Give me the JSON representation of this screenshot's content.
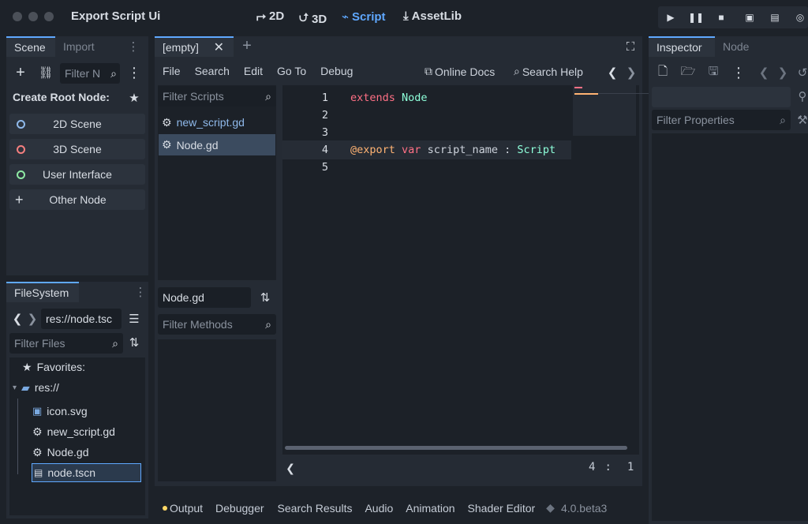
{
  "titlebar": {
    "title": "Export Script Ui",
    "workspaces": [
      {
        "label": "2D",
        "icon": "2d-icon"
      },
      {
        "label": "3D",
        "icon": "3d-icon"
      },
      {
        "label": "Script",
        "icon": "script-icon"
      },
      {
        "label": "AssetLib",
        "icon": "assetlib-icon"
      }
    ],
    "active_workspace": "Script"
  },
  "scene_dock": {
    "tabs": [
      "Scene",
      "Import"
    ],
    "filter_placeholder": "Filter N",
    "create_root_label": "Create Root Node:",
    "root_buttons": [
      {
        "label": "2D Scene",
        "color": "#8fb9ea"
      },
      {
        "label": "3D Scene",
        "color": "#f57f7f"
      },
      {
        "label": "User Interface",
        "color": "#8eeaa4"
      },
      {
        "label": "Other Node",
        "color": "#d8dde4"
      }
    ]
  },
  "filesystem_dock": {
    "tab": "FileSystem",
    "path": "res://node.tsc",
    "filter_placeholder": "Filter Files",
    "favorites_label": "Favorites:",
    "root_label": "res://",
    "files": [
      {
        "name": "icon.svg",
        "icon": "image-icon"
      },
      {
        "name": "new_script.gd",
        "icon": "gear-icon"
      },
      {
        "name": "Node.gd",
        "icon": "gear-icon"
      },
      {
        "name": "node.tscn",
        "icon": "scene-icon"
      }
    ]
  },
  "script_editor": {
    "tab": "[empty]",
    "menu": [
      "File",
      "Search",
      "Edit",
      "Go To",
      "Debug"
    ],
    "online_docs": "Online Docs",
    "search_help": "Search Help",
    "filter_scripts_placeholder": "Filter Scripts",
    "scripts": [
      "new_script.gd",
      "Node.gd"
    ],
    "current_script": "Node.gd",
    "filter_methods_placeholder": "Filter Methods",
    "line_numbers": [
      "1",
      "2",
      "3",
      "4",
      "5"
    ],
    "line1": {
      "kw": "extends",
      "type": "Node"
    },
    "line4": {
      "annot": "@export",
      "kw": "var",
      "name": "script_name",
      "colon": ":",
      "type": "Script"
    },
    "cursor_line": "4",
    "cursor_sep": ":",
    "cursor_col": "1"
  },
  "bottom_panel": {
    "tabs": [
      "Output",
      "Debugger",
      "Search Results",
      "Audio",
      "Animation",
      "Shader Editor"
    ],
    "version": "4.0.beta3"
  },
  "inspector_dock": {
    "tabs": [
      "Inspector",
      "Node"
    ],
    "filter_placeholder": "Filter Properties"
  },
  "colors": {
    "accent": "#5fa8ff",
    "keyword": "#ff7085",
    "type": "#8effda",
    "annotation": "#ffb373",
    "output_dot": "#ffd866"
  }
}
